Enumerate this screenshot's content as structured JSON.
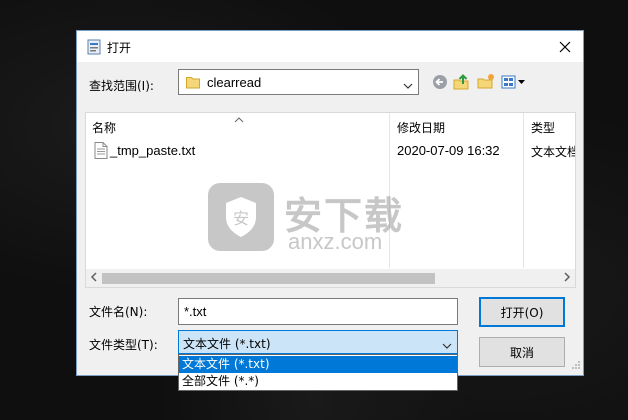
{
  "dialog": {
    "title": "打开",
    "look_in_label": "查找范围(I):",
    "look_in_value": "clearread"
  },
  "toolbar": {
    "icons": [
      "back-icon",
      "up-folder-icon",
      "new-folder-icon",
      "view-menu-icon"
    ]
  },
  "file_list": {
    "columns": [
      "名称",
      "修改日期",
      "类型"
    ],
    "rows": [
      {
        "name": "_tmp_paste.txt",
        "date": "2020-07-09 16:32",
        "type": "文本文档"
      }
    ]
  },
  "watermark": {
    "shield_text": "安",
    "cn_text": "安下载",
    "en_text": "anxz.com"
  },
  "filename": {
    "label": "文件名(N):",
    "value": "*.txt"
  },
  "filetype": {
    "label": "文件类型(T):",
    "value": "文本文件 (*.txt)",
    "options": [
      "文本文件 (*.txt)",
      "全部文件 (*.*)"
    ],
    "selected_index": 0
  },
  "buttons": {
    "open": "打开(O)",
    "cancel": "取消"
  },
  "colors": {
    "accent": "#0078d7",
    "selection_bg": "#cce4f7"
  }
}
